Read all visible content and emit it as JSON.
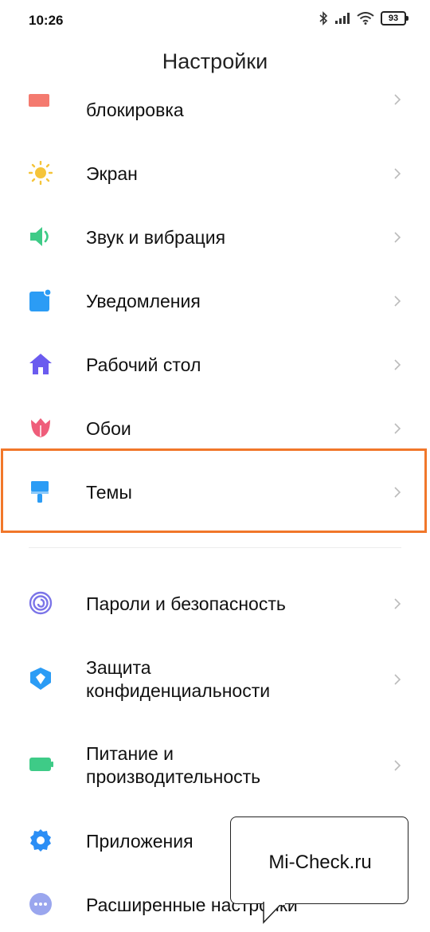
{
  "status_bar": {
    "time": "10:26",
    "battery": "93"
  },
  "page_title": "Настройки",
  "items": [
    {
      "label": "блокировка"
    },
    {
      "label": "Экран"
    },
    {
      "label": "Звук и вибрация"
    },
    {
      "label": "Уведомления"
    },
    {
      "label": "Рабочий стол"
    },
    {
      "label": "Обои"
    },
    {
      "label": "Темы"
    },
    {
      "label": "Пароли и безопасность"
    },
    {
      "label_line1": "Защита",
      "label_line2": "конфиденциальности"
    },
    {
      "label_line1": "Питание и",
      "label_line2": "производительность"
    },
    {
      "label": "Приложения"
    },
    {
      "label": "Расширенные настройки"
    }
  ],
  "callout": {
    "text": "Mi-Check.ru"
  },
  "colors": {
    "highlight": "#f1772a",
    "lock": "#f47a6f",
    "screen": "#f5c43a",
    "sound": "#3ecb87",
    "notif": "#2b9cf5",
    "desktop": "#6b5bef",
    "wallpaper": "#ef5d7a",
    "themes": "#2b9cf5",
    "security": "#7b74e8",
    "privacy": "#2b9cf5",
    "battery": "#3ecb87",
    "apps": "#2b8ef5",
    "advanced": "#9aa6ee"
  }
}
